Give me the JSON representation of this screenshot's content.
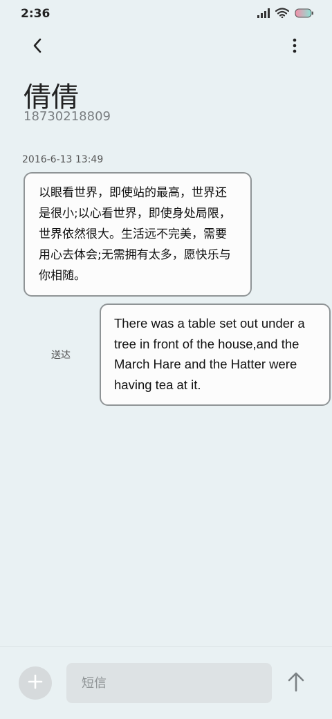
{
  "status_bar": {
    "time": "2:36"
  },
  "header": {
    "contact_name": "倩倩",
    "contact_number": "18730218809"
  },
  "messages": [
    {
      "direction": "incoming",
      "timestamp": "2016-6-13 13:49",
      "text": "以眼看世界，即使站的最高，世界还是很小;以心看世界，即使身处局限，世界依然很大。生活远不完美，需要用心去体会;无需拥有太多，愿快乐与你相随。"
    },
    {
      "direction": "outgoing",
      "status": "送达",
      "text": "There was a table set out under a tree in front of the house,and the March Hare and the Hatter were having tea at it."
    }
  ],
  "composer": {
    "placeholder": "短信"
  },
  "icons": {
    "back": "chevron-left-icon",
    "more": "more-vertical-icon",
    "add": "plus-icon",
    "send": "arrow-up-icon",
    "signal": "signal-icon",
    "wifi": "wifi-icon",
    "battery": "battery-icon"
  },
  "colors": {
    "background": "#e9f1f3",
    "bubble_border": "#8f9496",
    "battery_gradient_start": "#f28fa8",
    "battery_gradient_end": "#8ee3d6"
  }
}
